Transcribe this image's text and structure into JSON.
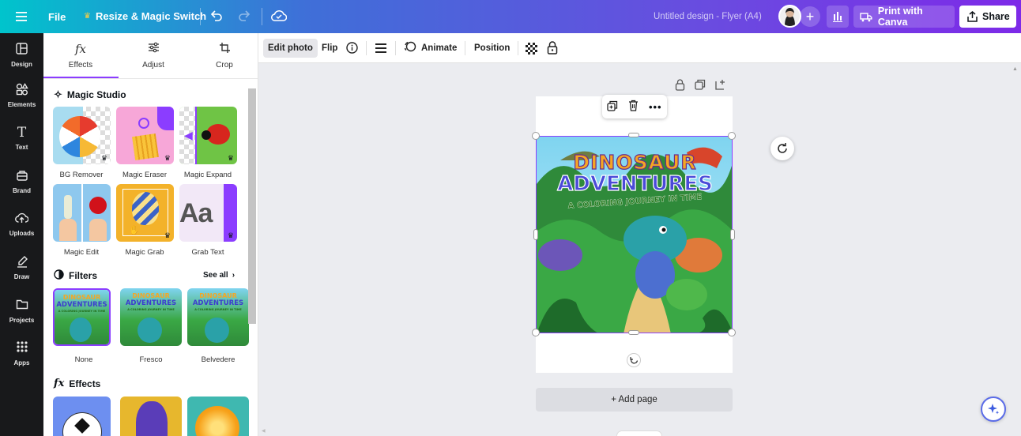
{
  "topbar": {
    "menu_icon": "hamburger-icon",
    "file_label": "File",
    "resize_label": "Resize & Magic Switch",
    "design_title": "Untitled design - Flyer (A4)",
    "print_label": "Print with Canva",
    "share_label": "Share"
  },
  "rail": {
    "items": [
      {
        "label": "Design",
        "icon": "design-icon"
      },
      {
        "label": "Elements",
        "icon": "elements-icon"
      },
      {
        "label": "Text",
        "icon": "text-icon"
      },
      {
        "label": "Brand",
        "icon": "brand-icon"
      },
      {
        "label": "Uploads",
        "icon": "uploads-icon"
      },
      {
        "label": "Draw",
        "icon": "draw-icon"
      },
      {
        "label": "Projects",
        "icon": "projects-icon"
      },
      {
        "label": "Apps",
        "icon": "apps-icon"
      }
    ]
  },
  "panel": {
    "tabs": [
      {
        "label": "Effects",
        "icon": "fx-icon"
      },
      {
        "label": "Adjust",
        "icon": "sliders-icon"
      },
      {
        "label": "Crop",
        "icon": "crop-icon"
      }
    ],
    "magic_studio": {
      "title": "Magic Studio",
      "tools": [
        {
          "label": "BG Remover"
        },
        {
          "label": "Magic Eraser"
        },
        {
          "label": "Magic Expand"
        },
        {
          "label": "Magic Edit"
        },
        {
          "label": "Magic Grab"
        },
        {
          "label": "Grab Text"
        }
      ]
    },
    "filters": {
      "title": "Filters",
      "see_all": "See all",
      "items": [
        {
          "label": "None"
        },
        {
          "label": "Fresco"
        },
        {
          "label": "Belvedere"
        }
      ]
    },
    "effects": {
      "title": "Effects"
    }
  },
  "toolbar": {
    "edit_photo": "Edit photo",
    "flip": "Flip",
    "animate": "Animate",
    "position": "Position"
  },
  "canvas": {
    "cover_title_1": "DINOSAUR",
    "cover_title_2": "ADVENTURES",
    "cover_subtitle": "A COLORING JOURNEY IN TIME",
    "add_page": "+ Add page"
  },
  "thumb_text": {
    "t1": "DINOSAUR",
    "t2": "ADVENTURES",
    "t3": "A COLORING JOURNEY IN TIME"
  },
  "colors": {
    "brand_purple": "#8b3dff",
    "topbar_start": "#00c4cc",
    "topbar_end": "#7d2ae8",
    "rail_bg": "#18191b"
  }
}
